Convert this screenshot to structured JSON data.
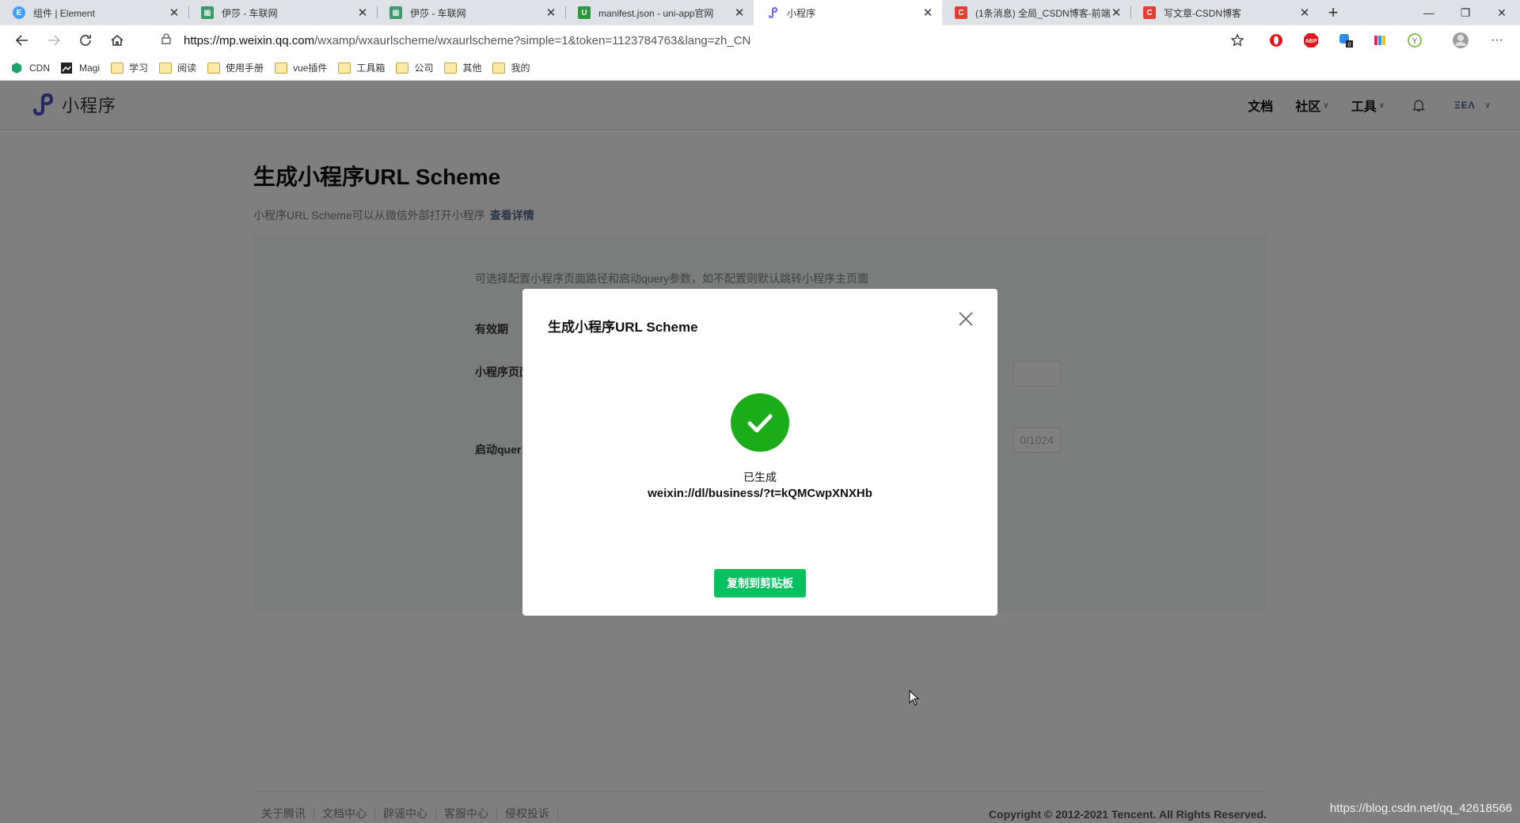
{
  "browser": {
    "tabs": [
      {
        "title": "组件 | Element",
        "favicon": "element-icon",
        "color": "#409eff"
      },
      {
        "title": "伊莎 - 车联网",
        "favicon": "grid-icon",
        "color": "#3a9a6a"
      },
      {
        "title": "伊莎 - 车联网",
        "favicon": "grid-icon",
        "color": "#3a9a6a"
      },
      {
        "title": "manifest.json - uni-app官网",
        "favicon": "uniapp-icon",
        "color": "#2b9939"
      },
      {
        "title": "小程序",
        "favicon": "miniprogram-icon",
        "color": "#6467f0",
        "active": true
      },
      {
        "title": "(1条消息) 全局_CSDN博客-前端",
        "favicon": "csdn-icon",
        "color": "#e33e33"
      },
      {
        "title": "写文章-CSDN博客",
        "favicon": "csdn-icon",
        "color": "#e33e33"
      }
    ],
    "new_tab": "+",
    "window_controls": {
      "minimize": "—",
      "restore": "❐",
      "close": "✕"
    },
    "url": {
      "host": "https://mp.weixin.qq.com",
      "path": "/wxamp/wxaurlscheme/wxaurlscheme?simple=1&token=1123784763&lang=zh_CN"
    },
    "bookmarks": [
      {
        "label": "CDN",
        "icon": "cdn-icon"
      },
      {
        "label": "Magi",
        "icon": "magi-icon"
      },
      {
        "label": "学习",
        "icon": "folder-icon"
      },
      {
        "label": "阅读",
        "icon": "folder-icon"
      },
      {
        "label": "使用手册",
        "icon": "folder-icon"
      },
      {
        "label": "vue插件",
        "icon": "folder-icon"
      },
      {
        "label": "工具箱",
        "icon": "folder-icon"
      },
      {
        "label": "公司",
        "icon": "folder-icon"
      },
      {
        "label": "其他",
        "icon": "folder-icon"
      },
      {
        "label": "我的",
        "icon": "folder-icon"
      }
    ]
  },
  "header": {
    "logo_text": "小程序",
    "nav": {
      "docs": "文档",
      "community": "社区",
      "tools": "工具"
    },
    "user_label": "ΞΕΛ"
  },
  "main": {
    "title": "生成小程序URL Scheme",
    "description": "小程序URL Scheme可以从微信外部打开小程序",
    "details_link": "查看详情",
    "tip": "可选择配置小程序页面路径和启动query参数，如不配置则默认跳转小程序主页面",
    "labels": {
      "validity": "有效期",
      "page_path": "小程序页面",
      "query": "启动quer"
    },
    "query_counter": "0/1024"
  },
  "modal": {
    "title": "生成小程序URL Scheme",
    "status": "已生成",
    "scheme": "weixin://dl/business/?t=kQMCwpXNXHb",
    "copy_button": "复制到剪贴板"
  },
  "footer": {
    "links": [
      "关于腾讯",
      "文档中心",
      "辟谣中心",
      "客服中心",
      "侵权投诉"
    ],
    "copyright": "Copyright © 2012-2021 Tencent. All Rights Reserved."
  },
  "watermark": "https://blog.csdn.net/qq_42618566",
  "colors": {
    "primary_green": "#07c160",
    "success_green": "#1aad19",
    "link_blue": "#576b95"
  }
}
